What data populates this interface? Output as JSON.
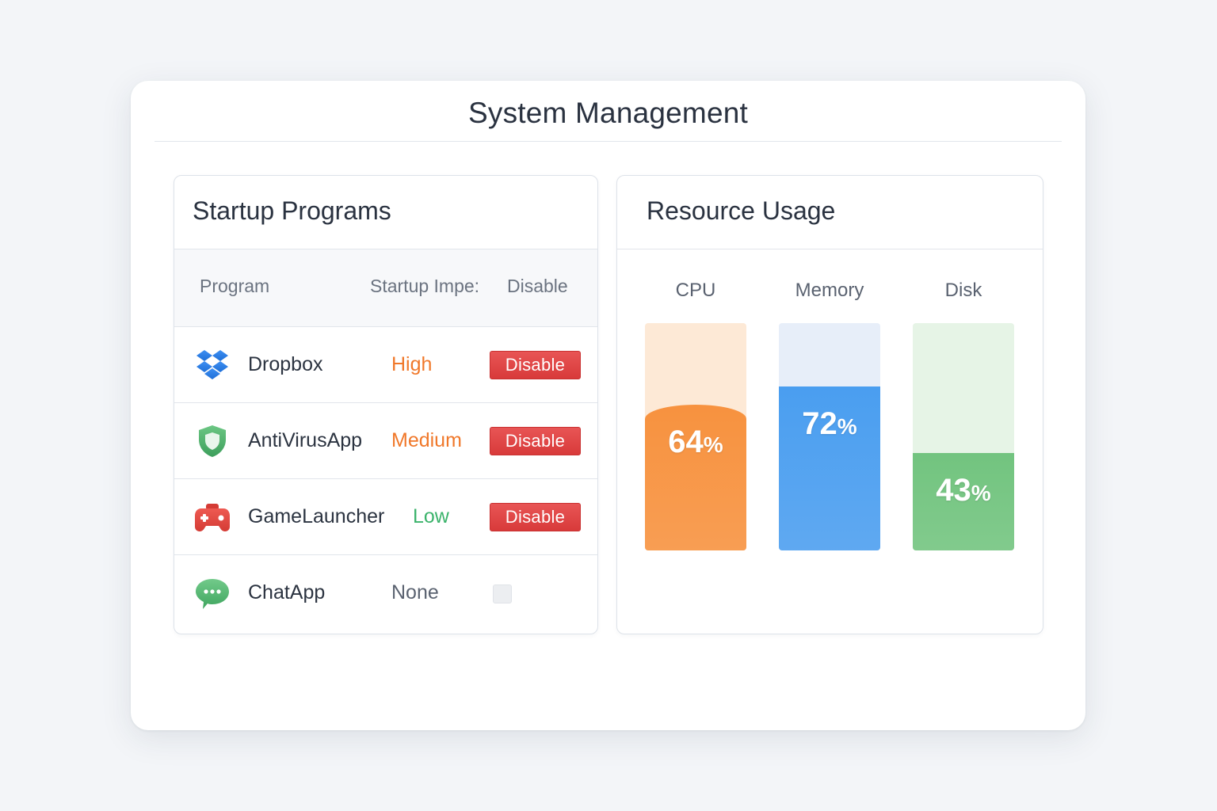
{
  "window": {
    "title": "System Management"
  },
  "startup": {
    "title": "Startup Programs",
    "headers": {
      "program": "Program",
      "impact": "Startup Impe:",
      "disable": "Disable"
    },
    "rows": [
      {
        "name": "Dropbox",
        "impact": "High",
        "impact_color": "#f0782a",
        "icon": "dropbox-icon",
        "action": "Disable"
      },
      {
        "name": "AntiVirusApp",
        "impact": "Medium",
        "impact_color": "#f0782a",
        "icon": "shield-icon",
        "action": "Disable"
      },
      {
        "name": "GameLauncher",
        "impact": "Low",
        "impact_color": "#3bb36b",
        "icon": "gamepad-icon",
        "action": "Disable"
      },
      {
        "name": "ChatApp",
        "impact": "None",
        "impact_color": "#5a6270",
        "icon": "chat-bubble-icon",
        "checked": false
      }
    ]
  },
  "resources": {
    "title": "Resource Usage",
    "gauges": [
      {
        "label": "CPU",
        "value": 64,
        "color": "#f7923f",
        "track_color": "#fde9d6"
      },
      {
        "label": "Memory",
        "value": 72,
        "color": "#4a9ef0",
        "track_color": "#e7eef9"
      },
      {
        "label": "Disk",
        "value": 43,
        "color": "#72c47f",
        "track_color": "#e6f4e6"
      }
    ]
  }
}
